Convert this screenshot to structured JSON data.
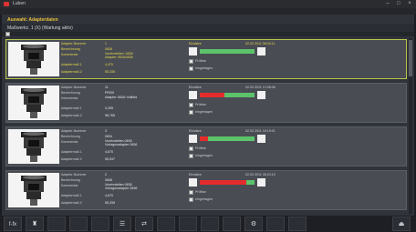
{
  "window": {
    "title": "Luben"
  },
  "header": {
    "title": "Auswahl: Adapterdaten",
    "subtitle": "Maßwerkz. 1 (X) (Wartung aktiv)"
  },
  "labels": {
    "adapter_number": "Adapter-Nummer",
    "description": "Bezeichnung",
    "comment": "Kommentar",
    "measure1": "Adaptermaß 1",
    "measure2": "Adaptermaß 2",
    "insertion": "Einsätze",
    "checked": "Prüfbar",
    "registered": "eingetragen"
  },
  "adapters": [
    {
      "number": "1",
      "description": "0836",
      "comment": "Voreinstellen: 0836\nAdapter 0834/0836",
      "measure1": "4,470",
      "measure2": "55,335",
      "date": "02.02.2011 08:00:11",
      "gauge_red": 0.0,
      "active": true
    },
    {
      "number": "11",
      "description": "PR00I",
      "comment": "Adapter 0834/ Vollbild",
      "measure1": "0,295",
      "measure2": "98,765",
      "date": "02.02.2011 12:08:08",
      "gauge_red": 0.45,
      "active": false
    },
    {
      "number": "3",
      "description": "0834",
      "comment": "Voreinstellen 0836\nVorlagenadapter 0836",
      "measure1": "4,670",
      "measure2": "55,537",
      "date": "02.02.2011 16:19:01",
      "gauge_red": 0.15,
      "active": false
    },
    {
      "number": "2",
      "description": "0836",
      "comment": "Voreinstellen 0836\nVorlagenadapter 0836",
      "measure1": "4,670",
      "measure2": "55,335",
      "date": "02.02.2011 06:23:10",
      "gauge_red": 0.85,
      "active": false
    }
  ],
  "footer": {
    "fx_label": "f-fx"
  }
}
